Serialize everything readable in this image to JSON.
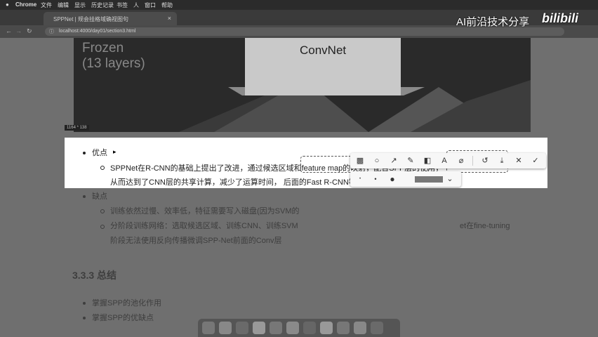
{
  "menubar": {
    "apple": "",
    "app": "Chrome",
    "items": [
      "文件",
      "编辑",
      "显示",
      "历史记录",
      "书签",
      "人",
      "窗口",
      "帮助"
    ]
  },
  "tab": {
    "title": "SPPNet | 规会挂格域确视图句",
    "close": "×"
  },
  "address": {
    "url": "localhost:4000/day01/section3.html"
  },
  "banner": {
    "frozen_line1": "Frozen",
    "frozen_line2": "(13 layers)",
    "convnet": "ConvNet",
    "dims": "1164 * 138"
  },
  "content": {
    "pros_title": "优点",
    "pros_line1_a": "SPPNet在R-CNN的基础上提出了改进，通过",
    "pros_line1_b": "候选区域和feature map",
    "pros_line1_c": "的映射，",
    "pros_line1_d": "配合SPP层",
    "pros_line1_e": "的使用，",
    "pros_line2": "从而达到了CNN层的共享计算，减少了运算时间， 后面的Fast R-CNN等也是受SPPNet的启发",
    "cons_title": "缺点",
    "cons_item1": "训练依然过慢、效率低，特征需要写入磁盘(因为SVM的",
    "cons_item2_a": "分阶段训练网络：选取候选区域、训练CNN、训练SVM",
    "cons_item2_b": "et在fine-tuning",
    "cons_item2_c": "阶段无法使用反向传播微调SPP-Net前面的Conv层",
    "section_title": "3.3.3 总结",
    "summary_item1": "掌握SPP的池化作用",
    "summary_item2": "掌握SPP的优缺点"
  },
  "toolbar": {
    "icons": [
      "mosaic-icon",
      "ellipse-icon",
      "arrow-icon",
      "pen-icon",
      "blur-icon",
      "text-icon",
      "eraser-icon",
      "undo-icon",
      "download-icon",
      "close-icon",
      "confirm-icon"
    ],
    "glyphs": [
      "▩",
      "○",
      "↗",
      "✎",
      "◧",
      "A",
      "⌀",
      "↺",
      "⤓",
      "✕",
      "✓"
    ],
    "size_glyphs": [
      "•",
      "•",
      "●"
    ],
    "dropdown": "⌄"
  },
  "watermark": {
    "text": "AI前沿技术分享",
    "logo": "bilibili"
  },
  "colors": {
    "page_bg": "#6f6f6f",
    "highlight": "#ffffff",
    "toolbar": "#f7f7f7"
  }
}
